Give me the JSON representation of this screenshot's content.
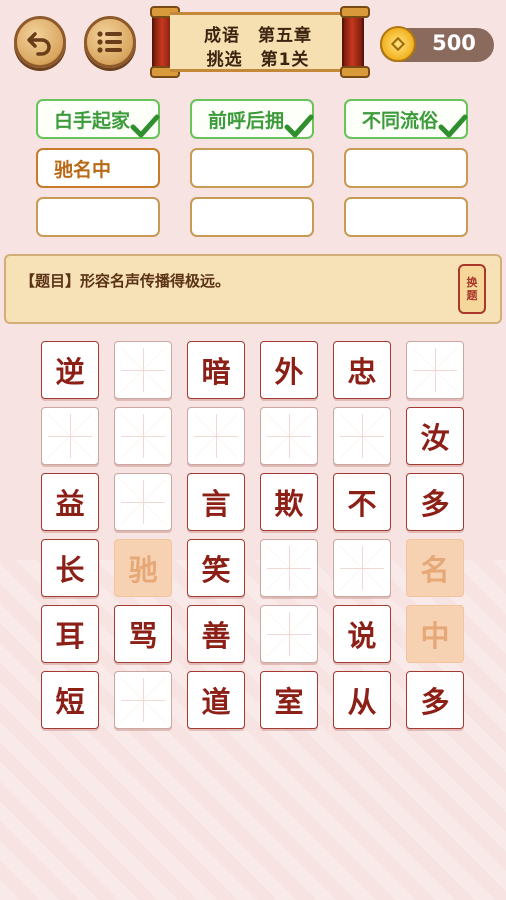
{
  "header": {
    "back_icon": "back-arrow-icon",
    "menu_icon": "menu-list-icon",
    "title_line1": "成语　第五章",
    "title_line2": "挑选　第1关",
    "coin_icon": "coin-icon",
    "coins": "500"
  },
  "answers": [
    {
      "text": "白手起家",
      "state": "done"
    },
    {
      "text": "前呼后拥",
      "state": "done"
    },
    {
      "text": "不同流俗",
      "state": "done"
    },
    {
      "text": "驰名中",
      "state": "active"
    },
    {
      "text": "",
      "state": "empty"
    },
    {
      "text": "",
      "state": "empty"
    },
    {
      "text": "",
      "state": "empty"
    },
    {
      "text": "",
      "state": "empty"
    },
    {
      "text": "",
      "state": "empty"
    }
  ],
  "question": {
    "text": "【题目】形容名声传播得极远。",
    "change_label_1": "换",
    "change_label_2": "题"
  },
  "tiles": [
    [
      "逆",
      "",
      "暗",
      "外",
      "忠",
      ""
    ],
    [
      "",
      "",
      "",
      "",
      "",
      "汝"
    ],
    [
      "益",
      "",
      "言",
      "欺",
      "不",
      "多"
    ],
    [
      "长",
      "驰",
      "笑",
      "",
      "",
      "名"
    ],
    [
      "耳",
      "骂",
      "善",
      "",
      "说",
      "中"
    ],
    [
      "短",
      "",
      "道",
      "室",
      "从",
      "多"
    ]
  ],
  "used_tiles": [
    "3-1",
    "3-5",
    "4-5"
  ],
  "colors": {
    "background": "#f7e4e2",
    "tile_text": "#8c1f16",
    "done_border": "#69c35b",
    "used_tile": "#f6d2b2"
  }
}
